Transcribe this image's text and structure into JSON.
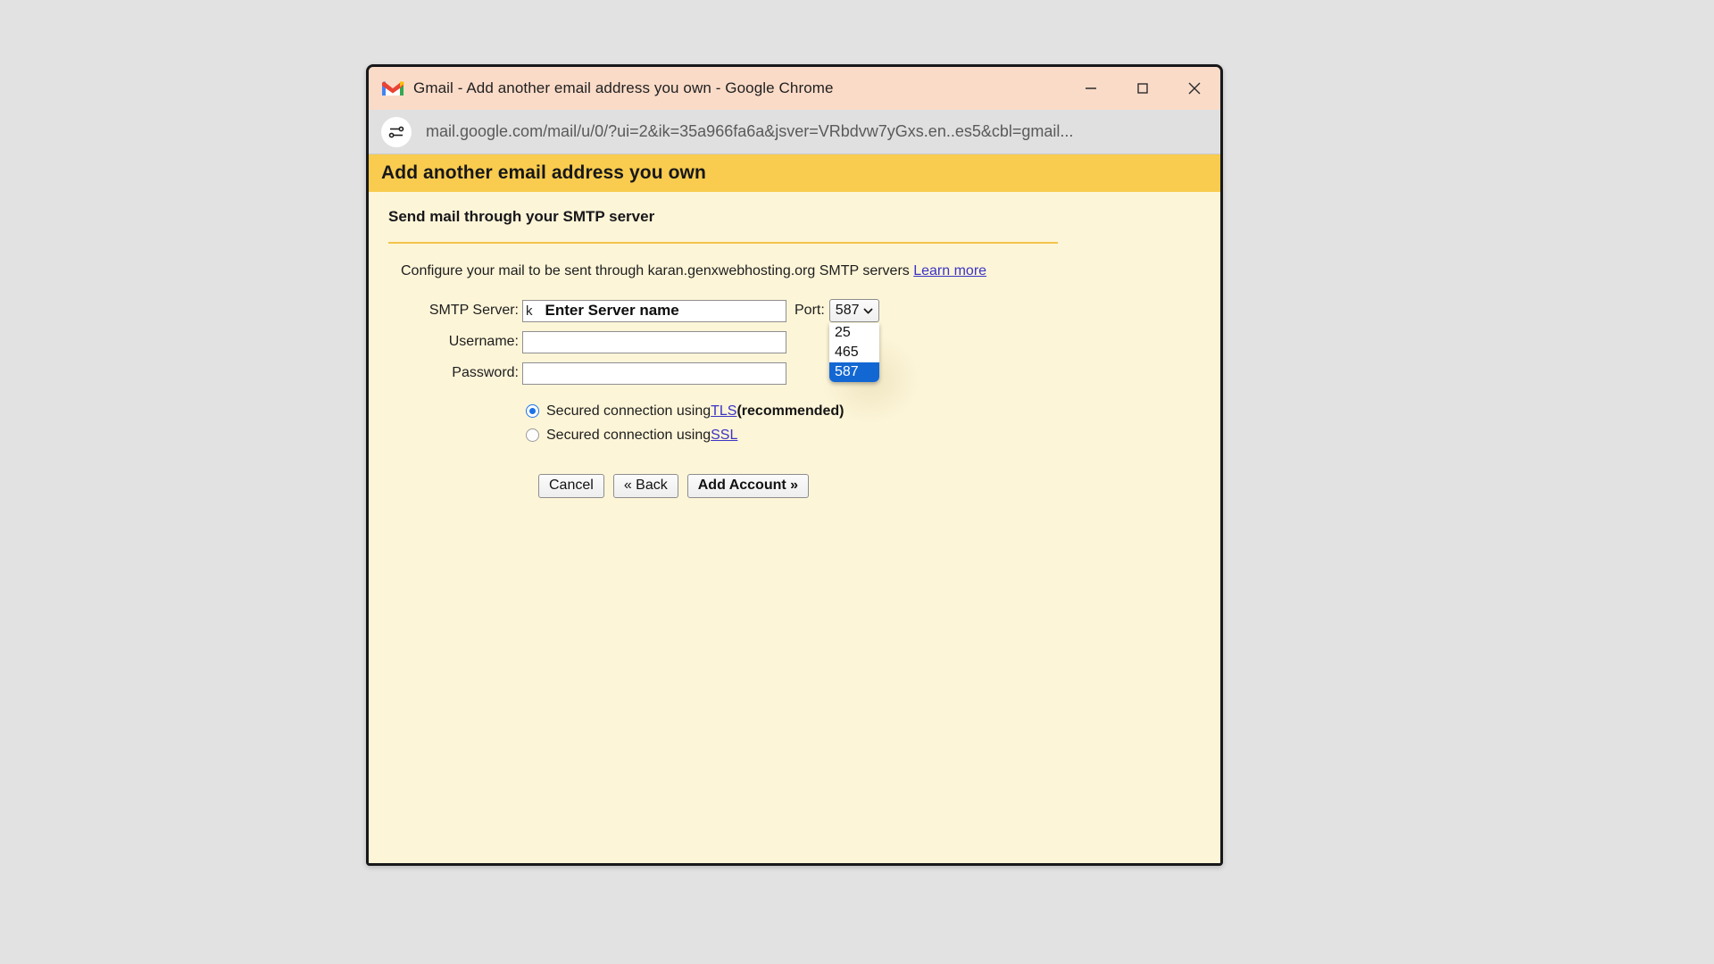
{
  "window": {
    "title": "Gmail - Add another email address you own - Google Chrome",
    "titlebar_color": "#fadbc8",
    "controls": {
      "minimize": "minimize-icon",
      "maximize": "maximize-icon",
      "close": "close-icon"
    }
  },
  "urlbar": {
    "site_settings_icon": "site-settings-icon",
    "url": "mail.google.com/mail/u/0/?ui=2&ik=35a966fa6a&jsver=VRbdvw7yGxs.en..es5&cbl=gmail...",
    "background": "#e0e0e0"
  },
  "page": {
    "header_title": "Add another email address you own",
    "header_color": "#f9cc4f",
    "body_color": "#fdf5d8",
    "section_title": "Send mail through your SMTP server",
    "intro_text": "Configure your mail to be sent through karan.genxwebhosting.org SMTP servers",
    "learn_more": "Learn more",
    "divider_color": "#f4c44a"
  },
  "form": {
    "smtp_server": {
      "label": "SMTP Server:",
      "value": "k",
      "annotation": "Enter Server name"
    },
    "username": {
      "label": "Username:",
      "value": "",
      "placeholder": ""
    },
    "password": {
      "label": "Password:",
      "value": "",
      "placeholder": ""
    },
    "port": {
      "label": "Port:",
      "selected": "587",
      "options": [
        "25",
        "465",
        "587"
      ],
      "dropdown_open": true,
      "highlight_color": "#1267d2"
    },
    "security": {
      "options": [
        {
          "prefix": "Secured connection using ",
          "link": "TLS",
          "suffix": " (recommended)",
          "checked": true
        },
        {
          "prefix": "Secured connection using ",
          "link": "SSL",
          "suffix": "",
          "checked": false
        }
      ]
    },
    "buttons": {
      "cancel": "Cancel",
      "back": "« Back",
      "add_account": "Add Account »"
    }
  }
}
